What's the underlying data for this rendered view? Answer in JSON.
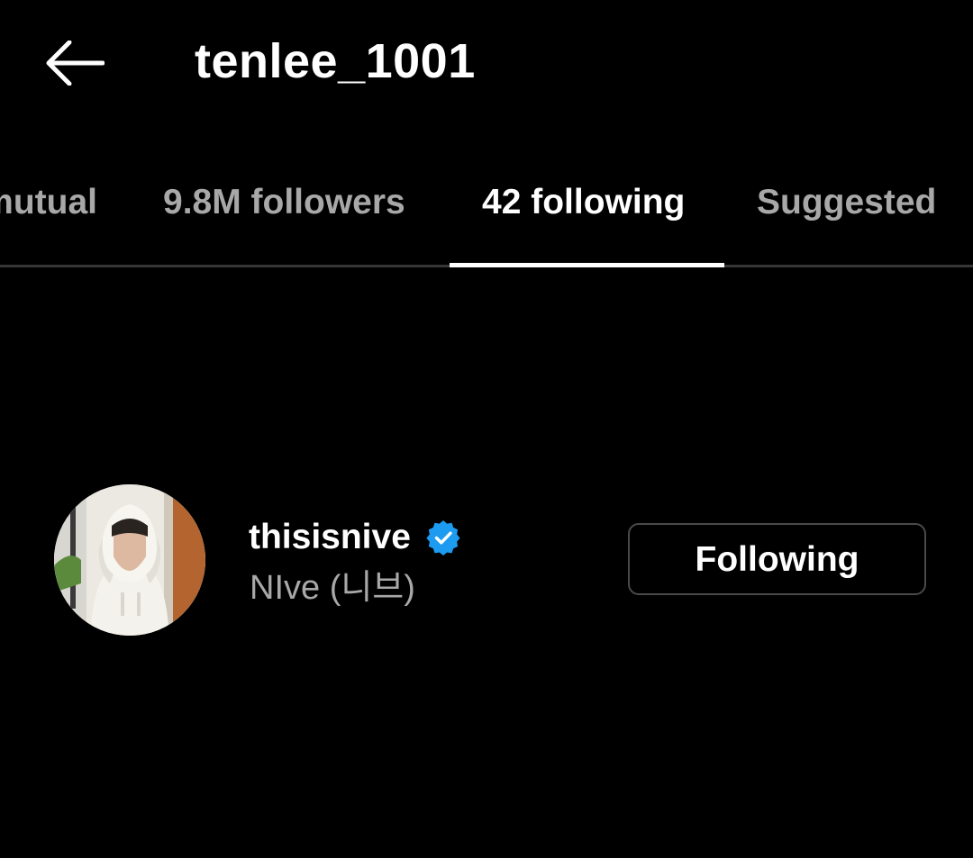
{
  "header": {
    "back_icon": "arrow-left-icon",
    "title": "tenlee_1001"
  },
  "tabs": [
    {
      "label": "mutual",
      "active": false
    },
    {
      "label": "9.8M followers",
      "active": false
    },
    {
      "label": "42 following",
      "active": true
    },
    {
      "label": "Suggested",
      "active": false
    }
  ],
  "list": [
    {
      "username": "thisisnive",
      "verified": true,
      "verified_icon": "verified-badge-icon",
      "full_name": "NIve (니브)",
      "button_label": "Following",
      "avatar": "profile-photo"
    }
  ],
  "colors": {
    "background": "#000000",
    "text_primary": "#ffffff",
    "text_secondary": "#a8a8a8",
    "verified_blue": "#1d9bf0",
    "divider": "#363636"
  }
}
